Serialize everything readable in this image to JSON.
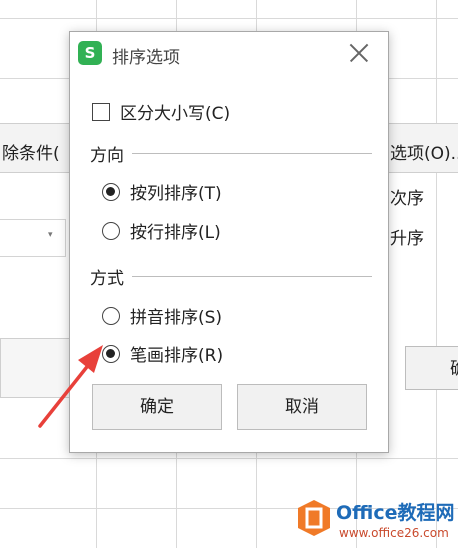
{
  "background": {
    "left_header_label": "除条件(",
    "right_header_label": "选项(O)..",
    "order_header": "次序",
    "order_value": "升序",
    "combo_arrow": "▾",
    "ok_fragment": "确"
  },
  "dialog": {
    "app_logo_letter": "S",
    "title": "排序选项",
    "case_sensitive_label": "区分大小写(C)",
    "case_sensitive_checked": false,
    "direction_group": "方向",
    "direction_options": [
      {
        "label": "按列排序(T)",
        "checked": true
      },
      {
        "label": "按行排序(L)",
        "checked": false
      }
    ],
    "method_group": "方式",
    "method_options": [
      {
        "label": "拼音排序(S)",
        "checked": false
      },
      {
        "label": "笔画排序(R)",
        "checked": true
      }
    ],
    "ok_label": "确定",
    "cancel_label": "取消"
  },
  "watermark": {
    "brand": "Office教程网",
    "url": "www.office26.com"
  },
  "colors": {
    "arrow": "#e8403a",
    "logo_green": "#31b154",
    "watermark_orange": "#f07a28",
    "watermark_blue": "#1e6bb8"
  }
}
